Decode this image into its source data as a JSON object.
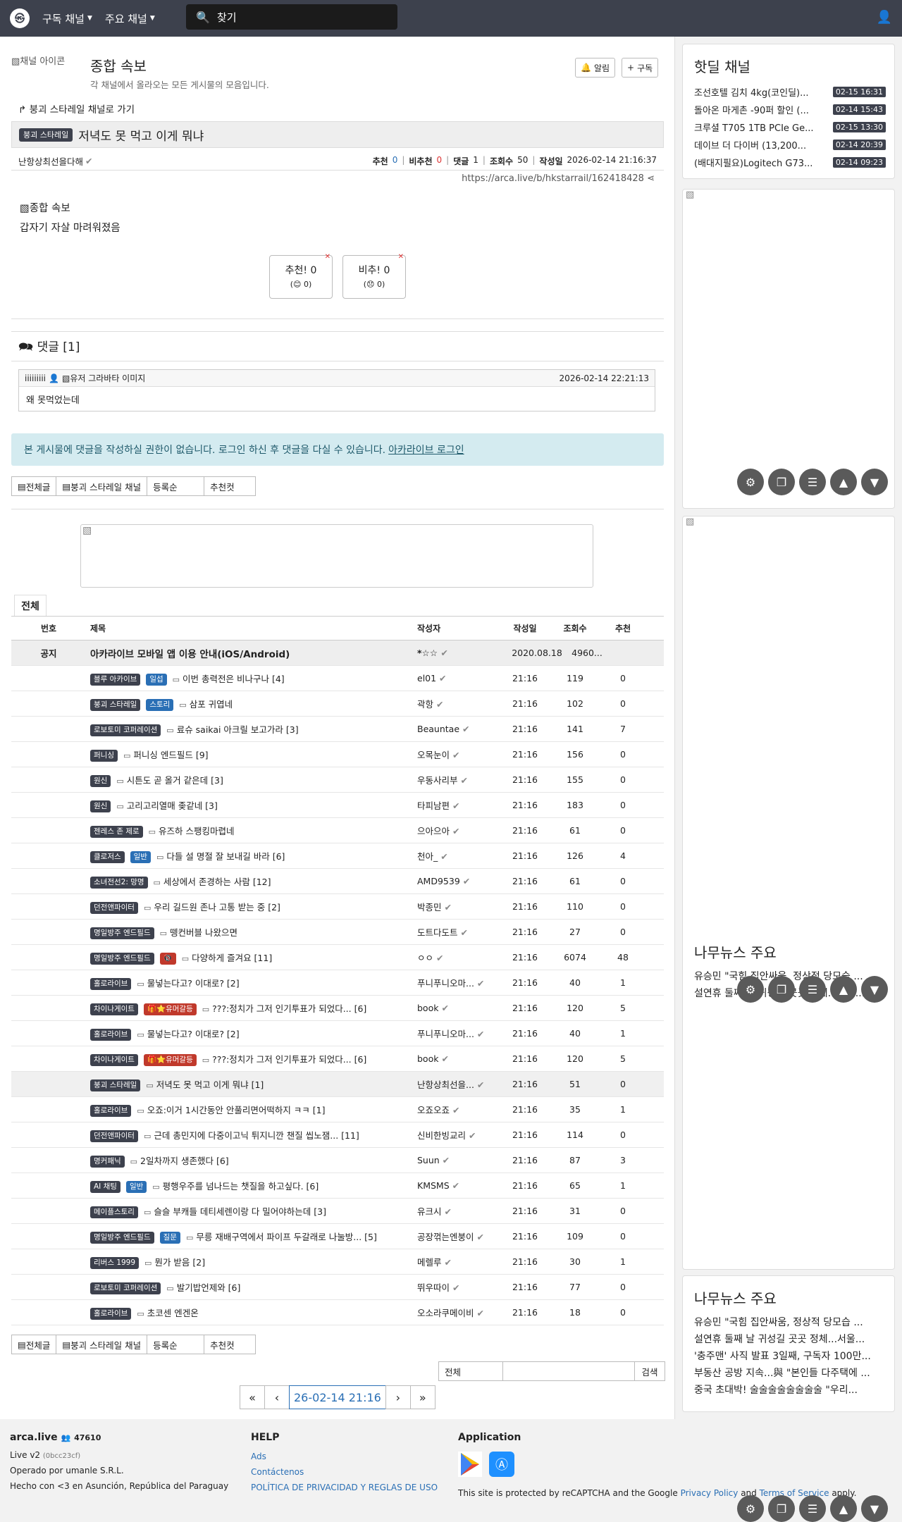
{
  "topbar": {
    "logo": "arca-logo-icon",
    "menu_subscribed": "구독 채널",
    "menu_main": "주요 채널",
    "search_placeholder": "찾기"
  },
  "channel": {
    "image_alt": "채널 아이콘",
    "title": "종합 속보",
    "description": "각 채널에서 올라오는 모든 게시물의 모음입니다.",
    "alarm_label": "알림",
    "subscribe_label": "구독"
  },
  "article": {
    "back_link": "붕괴 스타레일 채널로 가기",
    "category": "붕괴 스타레일",
    "title": "저녁도 못 먹고 이게 뭐냐",
    "author": "난항상최선을다해",
    "rec_label": "추천",
    "rec": "0",
    "unrec_label": "비추천",
    "unrec": "0",
    "cmt_label": "댓글",
    "cmt": "1",
    "view_label": "조회수",
    "views": "50",
    "date_label": "작성일",
    "date": "2026-02-14 21:16:37",
    "url": "https://arca.live/b/hkstarrail/162418428",
    "image_alt": "종합 속보",
    "body": "갑자기 자살 마려워졌음",
    "vote_up": "추천! 0",
    "vote_up_sub": "(😊 0)",
    "vote_down": "비추! 0",
    "vote_down_sub": "(😞 0)"
  },
  "comments": {
    "title": "댓글 [1]",
    "items": [
      {
        "user": "iiiiiiiii",
        "avatar_alt": "유저 그라바타 이미지",
        "date": "2026-02-14 22:21:13",
        "text": "왜 못먹었는데"
      }
    ]
  },
  "alert": {
    "text": "본 게시물에 댓글을 작성하실 권한이 없습니다. 로그인 하신 후 댓글을 다실 수 있습니다.",
    "link": "아카라이브 로그인"
  },
  "list_buttons": [
    "전체글",
    "붕괴 스타레일 채널",
    "등록순",
    "추천컷"
  ],
  "tab": "전체",
  "table": {
    "headers": [
      "번호",
      "제목",
      "작성자",
      "작성일",
      "조회수",
      "추천"
    ],
    "notice": {
      "no": "공지",
      "title": "아카라이브 모바일 앱 이용 안내(iOS/Android)",
      "author": "*☆☆",
      "date": "2020.08.18",
      "views": "4960..."
    },
    "rows": [
      {
        "badges": [
          "블루 아카이브",
          "일섭"
        ],
        "title": "이번 총력전은 비나구나 [4]",
        "author": "el01",
        "date": "21:16",
        "views": "119",
        "rec": "0"
      },
      {
        "badges": [
          "붕괴 스타레일",
          "스토리"
        ],
        "title": "삼포 귀엽네",
        "author": "곽항",
        "date": "21:16",
        "views": "102",
        "rec": "0"
      },
      {
        "badges": [
          "로보토미 코퍼레이션"
        ],
        "title": "료슈 saikai 아크릴 보고가라 [3]",
        "author": "Beauntae",
        "date": "21:16",
        "views": "141",
        "rec": "7"
      },
      {
        "badges": [
          "퍼니싱"
        ],
        "title": "퍼니싱 엔드필드 [9]",
        "author": "오목눈이",
        "date": "21:16",
        "views": "156",
        "rec": "0"
      },
      {
        "badges": [
          "원신"
        ],
        "title": "시튼도 곧 올거 같은데 [3]",
        "author": "우동사리부",
        "date": "21:16",
        "views": "155",
        "rec": "0"
      },
      {
        "badges": [
          "원신"
        ],
        "title": "고리고리열매 좆같네 [3]",
        "author": "타피남편",
        "date": "21:16",
        "views": "183",
        "rec": "0"
      },
      {
        "badges": [
          "젠레스 존 제로"
        ],
        "title": "유즈하 스팽킹마렵네",
        "author": "으아으아",
        "date": "21:16",
        "views": "61",
        "rec": "0"
      },
      {
        "badges": [
          "클로저스",
          "일반"
        ],
        "title": "다들 설 명절 잘 보내길 바라 [6]",
        "author": "천아_",
        "date": "21:16",
        "views": "126",
        "rec": "4"
      },
      {
        "badges": [
          "소녀전선2: 망명"
        ],
        "title": "세상에서 존경하는 사람 [12]",
        "author": "AMD9539",
        "date": "21:16",
        "views": "61",
        "rec": "0"
      },
      {
        "badges": [
          "던전앤파이터"
        ],
        "title": "우리 길드원 존나 고통 받는 중 [2]",
        "author": "박종민",
        "date": "21:16",
        "views": "110",
        "rec": "0"
      },
      {
        "badges": [
          "명일방주 엔드필드"
        ],
        "title": "뗑컨버블 나왔으면",
        "author": "도트다도트",
        "date": "21:16",
        "views": "27",
        "rec": "0"
      },
      {
        "badges": [
          "명일방주 엔드필드",
          "🔞"
        ],
        "title": "다양하게 즐겨요 [11]",
        "author": "ㅇㅇ",
        "date": "21:16",
        "views": "6074",
        "rec": "48"
      },
      {
        "badges": [
          "홀로라이브"
        ],
        "title": "물넣는다고? 이대로? [2]",
        "author": "푸니푸니오마...",
        "date": "21:16",
        "views": "40",
        "rec": "1"
      },
      {
        "badges": [
          "차이나게이트",
          "🎁⭐유머갈등"
        ],
        "title": "???:정치가 그저 인기투표가 되었다... [6]",
        "author": "book",
        "date": "21:16",
        "views": "120",
        "rec": "5"
      },
      {
        "badges": [
          "홀로라이브"
        ],
        "title": "물넣는다고? 이대로? [2]",
        "author": "푸니푸니오마...",
        "date": "21:16",
        "views": "40",
        "rec": "1"
      },
      {
        "badges": [
          "차이나게이트",
          "🎁⭐유머갈등"
        ],
        "title": "???:정치가 그저 인기투표가 되었다... [6]",
        "author": "book",
        "date": "21:16",
        "views": "120",
        "rec": "5"
      },
      {
        "badges": [
          "붕괴 스타레일"
        ],
        "title": "저녁도 못 먹고 이게 뭐냐 [1]",
        "author": "난항상최선을...",
        "date": "21:16",
        "views": "51",
        "rec": "0"
      },
      {
        "badges": [
          "홀로라이브"
        ],
        "title": "오죠:이거 1시간동안 안풀리면어떡하지 ㅋㅋ [1]",
        "author": "오죠오죠",
        "date": "21:16",
        "views": "35",
        "rec": "1"
      },
      {
        "badges": [
          "던전앤파이터"
        ],
        "title": "근데 총민지에 다중이고닉 튀지니깐 챈질 씹노잼... [11]",
        "author": "신비한빙교리",
        "date": "21:16",
        "views": "114",
        "rec": "0"
      },
      {
        "badges": [
          "명커패닉"
        ],
        "title": "2일차까지 생존했다 [6]",
        "author": "Suun",
        "date": "21:16",
        "views": "87",
        "rec": "3"
      },
      {
        "badges": [
          "AI 채팅",
          "일반"
        ],
        "title": "평행우주를 넘나드는 챗질을 하고싶다. [6]",
        "author": "KMSMS",
        "date": "21:16",
        "views": "65",
        "rec": "1"
      },
      {
        "badges": [
          "메이플스토리"
        ],
        "title": "슬슬 부캐들 데티세렌이랑 다 밀어야하는데 [3]",
        "author": "유크시",
        "date": "21:16",
        "views": "31",
        "rec": "0"
      },
      {
        "badges": [
          "명일방주 엔드필드",
          "질문"
        ],
        "title": "무릉 재배구역에서 파이프 두갈래로 나눌방... [5]",
        "author": "공장꺾는엔붕이",
        "date": "21:16",
        "views": "109",
        "rec": "0"
      },
      {
        "badges": [
          "리버스 1999"
        ],
        "title": "뭔가 받음 [2]",
        "author": "메렐루",
        "date": "21:16",
        "views": "30",
        "rec": "1"
      },
      {
        "badges": [
          "로보토미 코퍼레이션"
        ],
        "title": "발기밥언제와 [6]",
        "author": "뛰우따이",
        "date": "21:16",
        "views": "77",
        "rec": "0"
      },
      {
        "badges": [
          "홀로라이브"
        ],
        "title": "초코센 엔겐온",
        "author": "오소라쿠메이비",
        "date": "21:16",
        "views": "18",
        "rec": "0"
      }
    ]
  },
  "search": {
    "scope": "전체",
    "button": "검색"
  },
  "pager": {
    "first": "«",
    "prev": "‹",
    "current": "26-02-14 21:16",
    "next": "›",
    "last": "»"
  },
  "sidebar": {
    "hotdeal_title": "핫딜 채널",
    "hotdeals": [
      {
        "title": "조선호텔 김치 4kg(코인딜)...",
        "date": "02-15 16:31"
      },
      {
        "title": "돌아온 마게촌 -90퍼 할인 (...",
        "date": "02-14 15:43"
      },
      {
        "title": "크루셜 T705 1TB PCIe Ge...",
        "date": "02-15 13:30"
      },
      {
        "title": "데이브 더 다이버 (13,200...",
        "date": "02-14 20:39"
      },
      {
        "title": "(배대지필요)Logitech G73...",
        "date": "02-14 09:23"
      }
    ],
    "news_title": "나무뉴스 주요",
    "news_partial": [
      "유승민 \"국힘 집안싸움, 정상적 당모습 ...",
      "설연휴 둘째 날 귀성길 곳곳 정체...서울..."
    ],
    "news": [
      "유승민 \"국힘 집안싸움, 정상적 당모습 ...",
      "설연휴 둘째 날 귀성길 곳곳 정체...서울...",
      "'충주맨' 사직 발표 3일째, 구독자 100만...",
      "부동산 공방 지속...與 \"본인들 다주택에 ...",
      "중국 초대박! 술술술술술술술술 \"우리..."
    ]
  },
  "footer": {
    "site": "arca.live",
    "user_count": "47610",
    "version": "Live v2",
    "build": "(0bcc23cf)",
    "operator": "Operado por umanle S.R.L.",
    "made": "Hecho con <3 en Asunción, República del Paraguay",
    "help_title": "HELP",
    "help_links": [
      "Ads",
      "Contáctenos",
      "POLÍTICA DE PRIVACIDAD Y REGLAS DE USO"
    ],
    "app_title": "Application",
    "recaptcha_prefix": "This site is protected by reCAPTCHA and the Google",
    "privacy": "Privacy Policy",
    "and": "and",
    "terms": "Terms of Service",
    "apply": "apply."
  }
}
